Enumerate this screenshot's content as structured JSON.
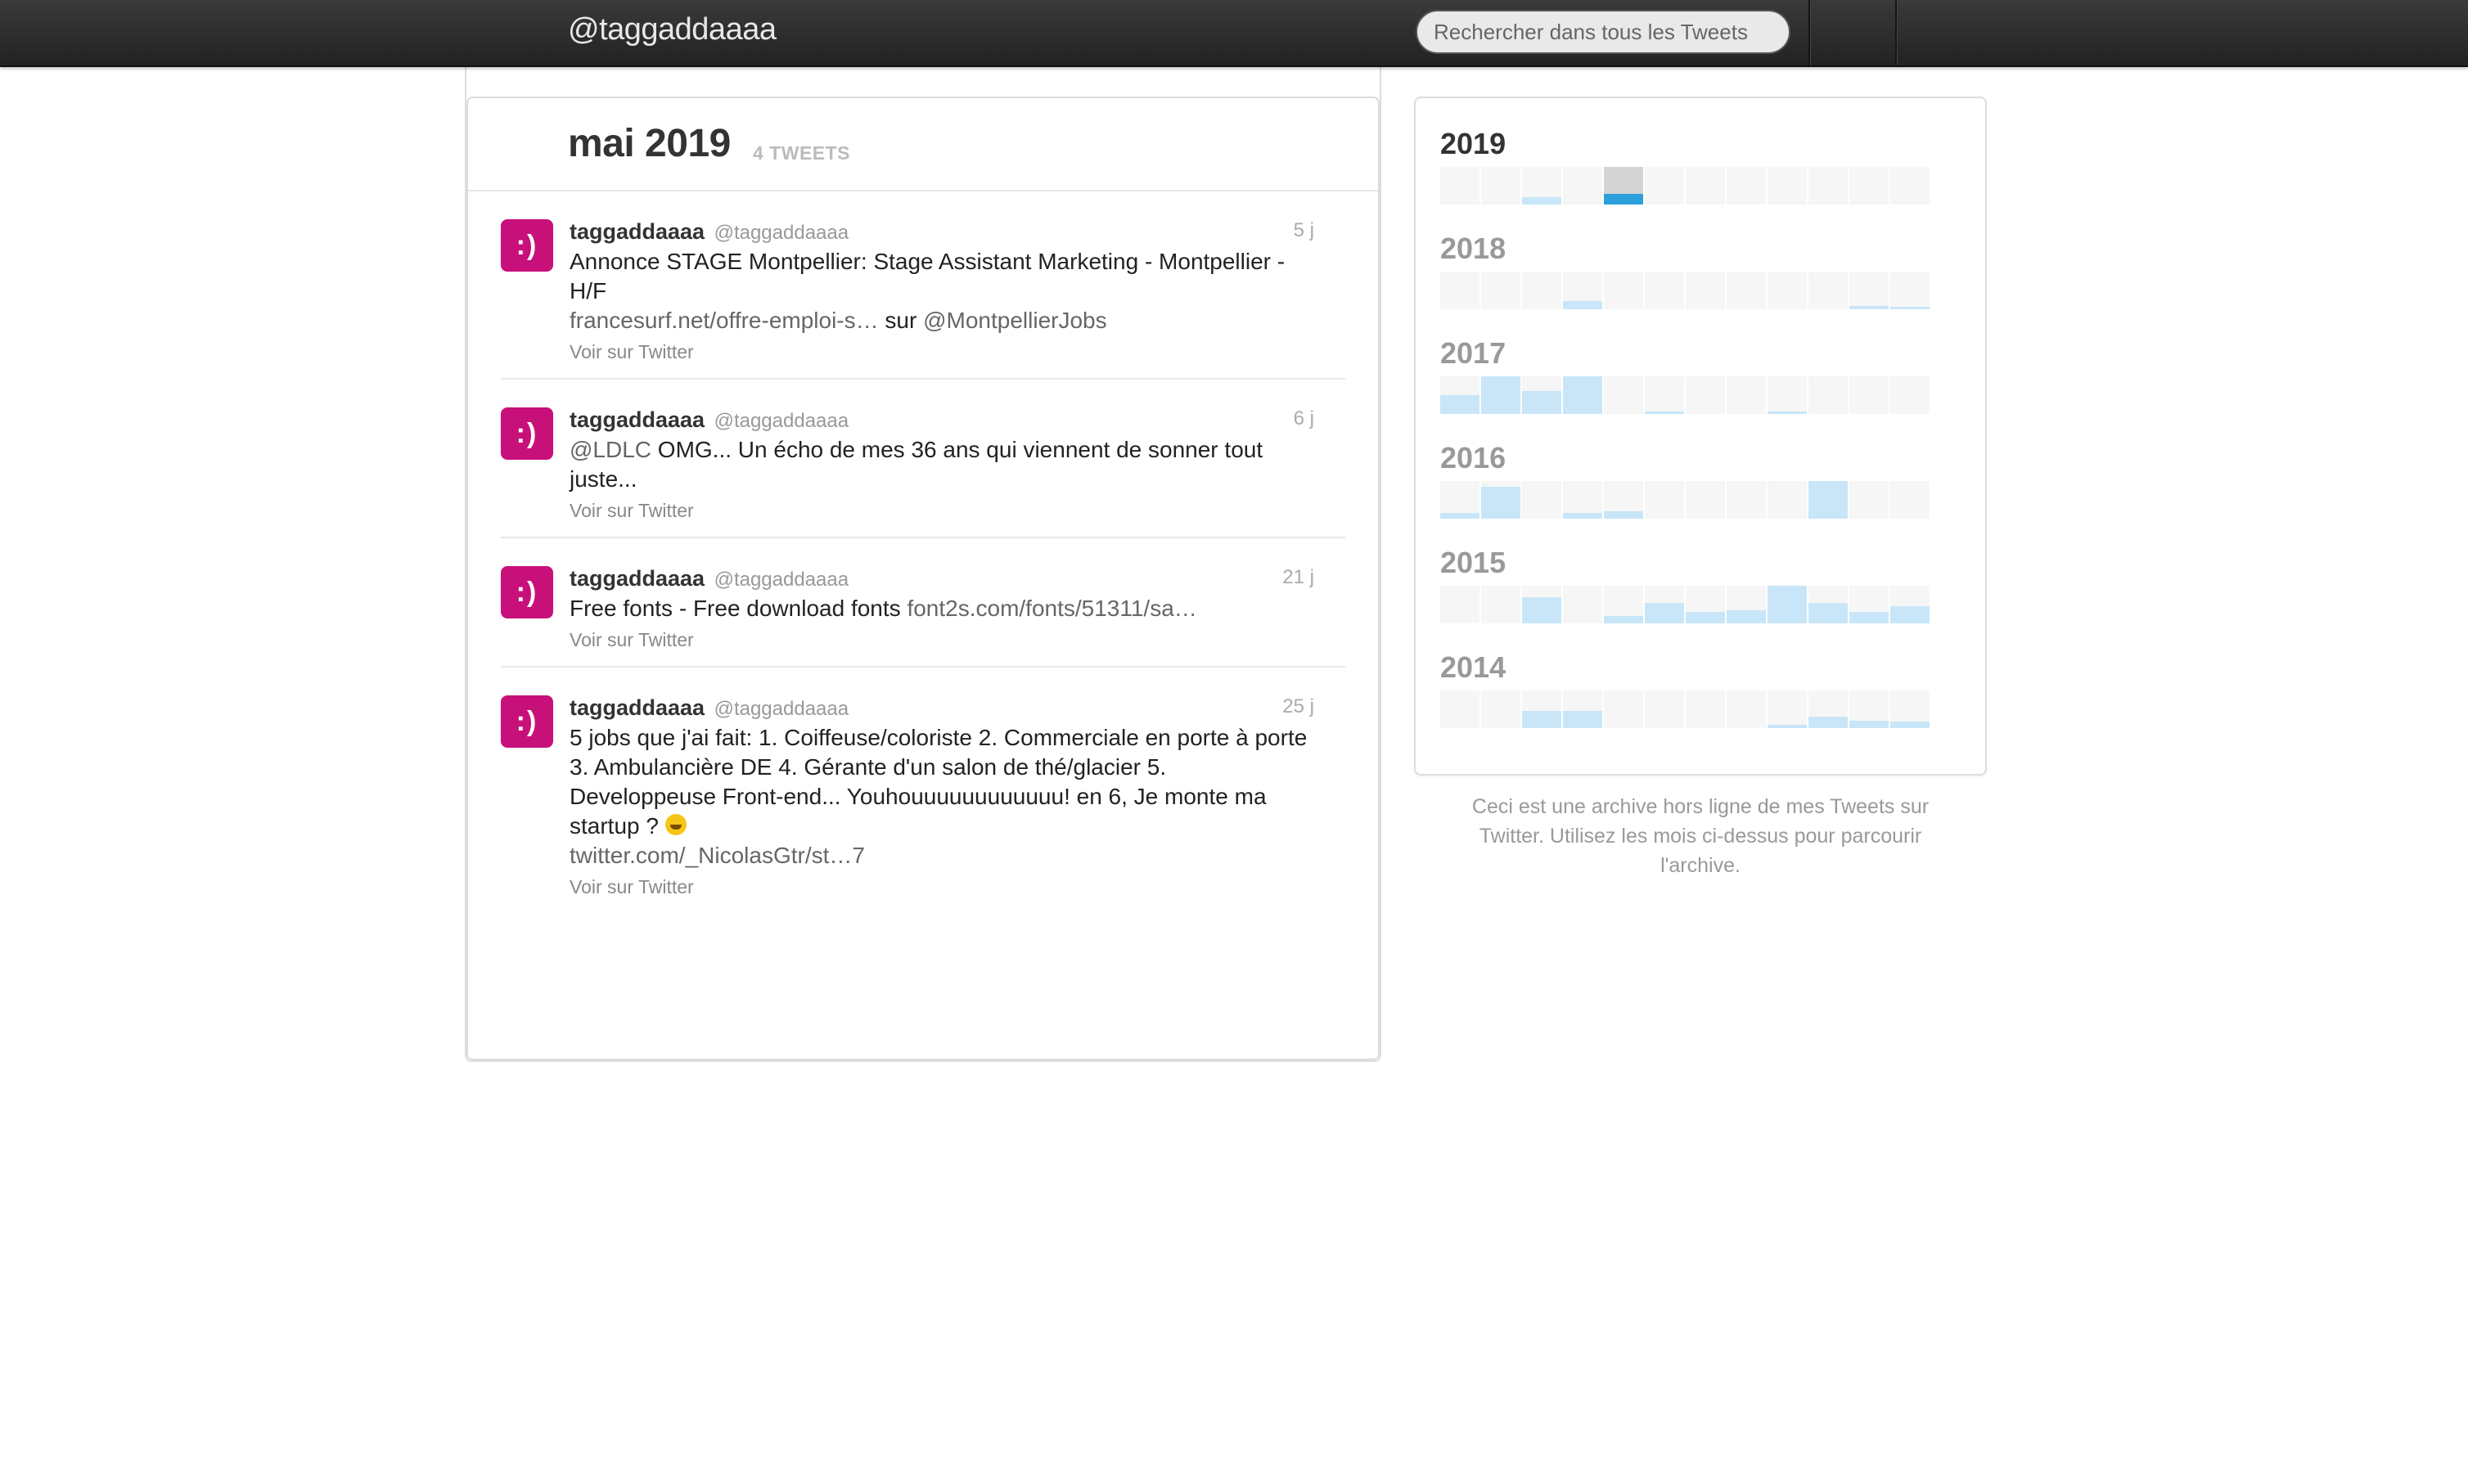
{
  "topbar": {
    "brand": "@taggaddaaaa",
    "search_placeholder": "Rechercher dans tous les Tweets"
  },
  "month": {
    "title": "mai 2019",
    "count": "4 TWEETS"
  },
  "colors": {
    "avatar_bg": "#c8107a",
    "bar_fill": "#c8e6f8",
    "bar_selected": "#2a9fdc",
    "topbar": "#2d2d2d"
  },
  "tweets": [
    {
      "avatar_text": ":)",
      "name": "taggaddaaaa",
      "handle": "@taggaddaaaa",
      "time": "5 j",
      "text_a": "Annonce STAGE Montpellier: Stage Assistant Marketing - Montpellier - H/F",
      "link_a": "francesurf.net/offre-emploi-s…",
      "text_b": " sur ",
      "link_b": "@MontpellierJobs",
      "view": "Voir sur Twitter"
    },
    {
      "avatar_text": ":)",
      "name": "taggaddaaaa",
      "handle": "@taggaddaaaa",
      "time": "6 j",
      "link_a": "@LDLC",
      "text_a": " OMG... Un écho de mes 36 ans qui viennent de sonner tout juste...",
      "view": "Voir sur Twitter"
    },
    {
      "avatar_text": ":)",
      "name": "taggaddaaaa",
      "handle": "@taggaddaaaa",
      "time": "21 j",
      "text_a": "Free fonts - Free download fonts ",
      "link_a": "font2s.com/fonts/51311/sa…",
      "view": "Voir sur Twitter"
    },
    {
      "avatar_text": ":)",
      "name": "taggaddaaaa",
      "handle": "@taggaddaaaa",
      "time": "25 j",
      "text_a": "5 jobs que j'ai fait: 1. Coiffeuse/coloriste 2. Commerciale en porte à porte 3. Ambulancière DE 4. Gérante d'un salon de thé/glacier 5. Developpeuse Front-end... Youhouuuuuuuuuuuu! en 6, Je monte ma startup ? ",
      "emoji": "grinning-face",
      "link_a": "twitter.com/_NicolasGtr/st…7",
      "view": "Voir sur Twitter"
    }
  ],
  "archive": {
    "years": [
      {
        "year": "2019",
        "active": true,
        "selected_month": 4,
        "levels": [
          0,
          0,
          0.2,
          0,
          1.0,
          0,
          0,
          0,
          0,
          0,
          0,
          0
        ]
      },
      {
        "year": "2018",
        "active": false,
        "selected_month": null,
        "levels": [
          0,
          0,
          0,
          0.22,
          0,
          0,
          0,
          0,
          0,
          0,
          0.08,
          0.06
        ]
      },
      {
        "year": "2017",
        "active": false,
        "selected_month": null,
        "levels": [
          0.5,
          1.0,
          0.6,
          1.0,
          0,
          0.06,
          0,
          0,
          0.06,
          0,
          0,
          0
        ]
      },
      {
        "year": "2016",
        "active": false,
        "selected_month": null,
        "levels": [
          0.15,
          0.85,
          0,
          0.15,
          0.2,
          0,
          0,
          0,
          0,
          1.0,
          0,
          0
        ]
      },
      {
        "year": "2015",
        "active": false,
        "selected_month": null,
        "levels": [
          0,
          0,
          0.7,
          0,
          0.2,
          0.55,
          0.3,
          0.35,
          1.0,
          0.55,
          0.3,
          0.45
        ]
      },
      {
        "year": "2014",
        "active": false,
        "selected_month": null,
        "levels": [
          0,
          0,
          0.45,
          0.45,
          0,
          0,
          0,
          0,
          0.08,
          0.3,
          0.2,
          0.18
        ]
      }
    ],
    "note": "Ceci est une archive hors ligne de mes Tweets sur Twitter. Utilisez les mois ci-dessus pour parcourir l'archive."
  }
}
